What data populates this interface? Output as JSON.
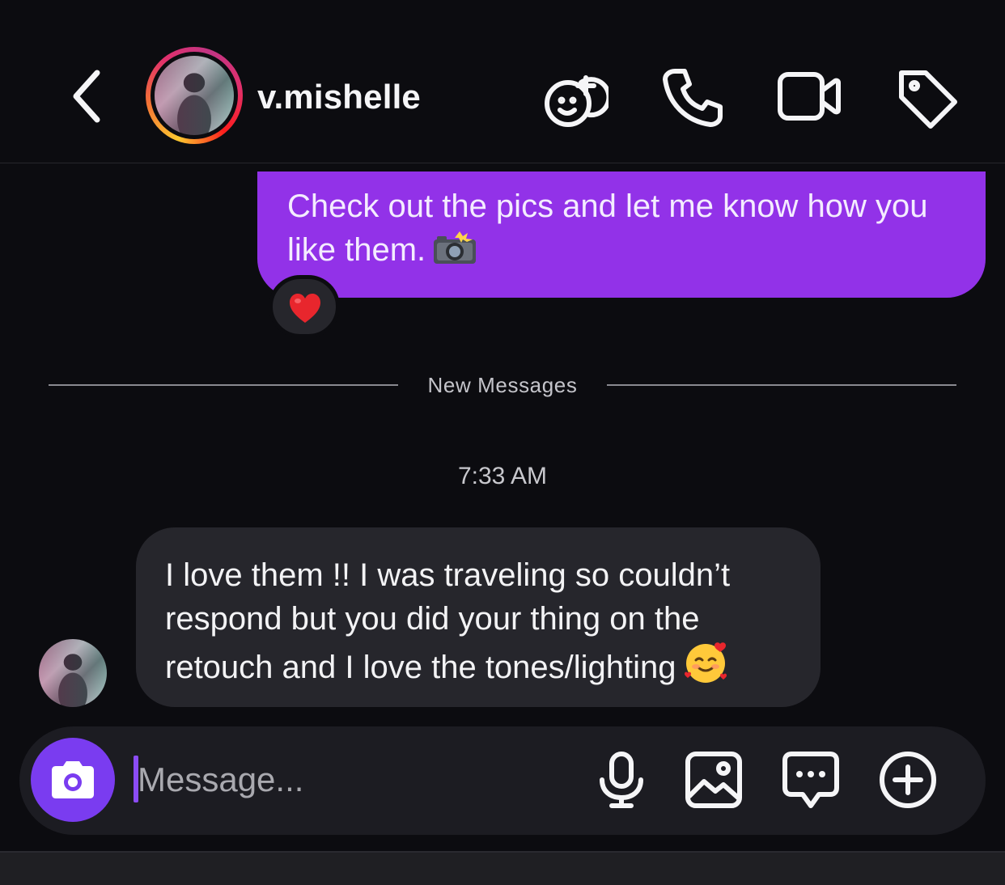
{
  "header": {
    "username": "v.mishelle",
    "icons": [
      "back-chevron-icon",
      "games-icon",
      "phone-icon",
      "video-camera-icon",
      "tag-icon"
    ]
  },
  "messages": {
    "outgoing_text": "Check out the pics and let me know how you like them.",
    "outgoing_emoji": "camera-with-flash",
    "reaction": "red-heart",
    "divider_label": "New Messages",
    "timestamp": "7:33 AM",
    "incoming_text": "I love them !! I was traveling so couldn’t respond but you did your thing on the retouch and I love the tones/lighting",
    "incoming_emoji": "smiling-face-with-hearts"
  },
  "composer": {
    "placeholder": "Message...",
    "icons": [
      "camera-icon",
      "microphone-icon",
      "gallery-icon",
      "sticker-chat-icon",
      "plus-icon"
    ]
  },
  "colors": {
    "background": "#0c0c10",
    "outgoing_bubble": "#9232e8",
    "incoming_bubble": "#26262c",
    "camera_button": "#7a3cf0"
  }
}
